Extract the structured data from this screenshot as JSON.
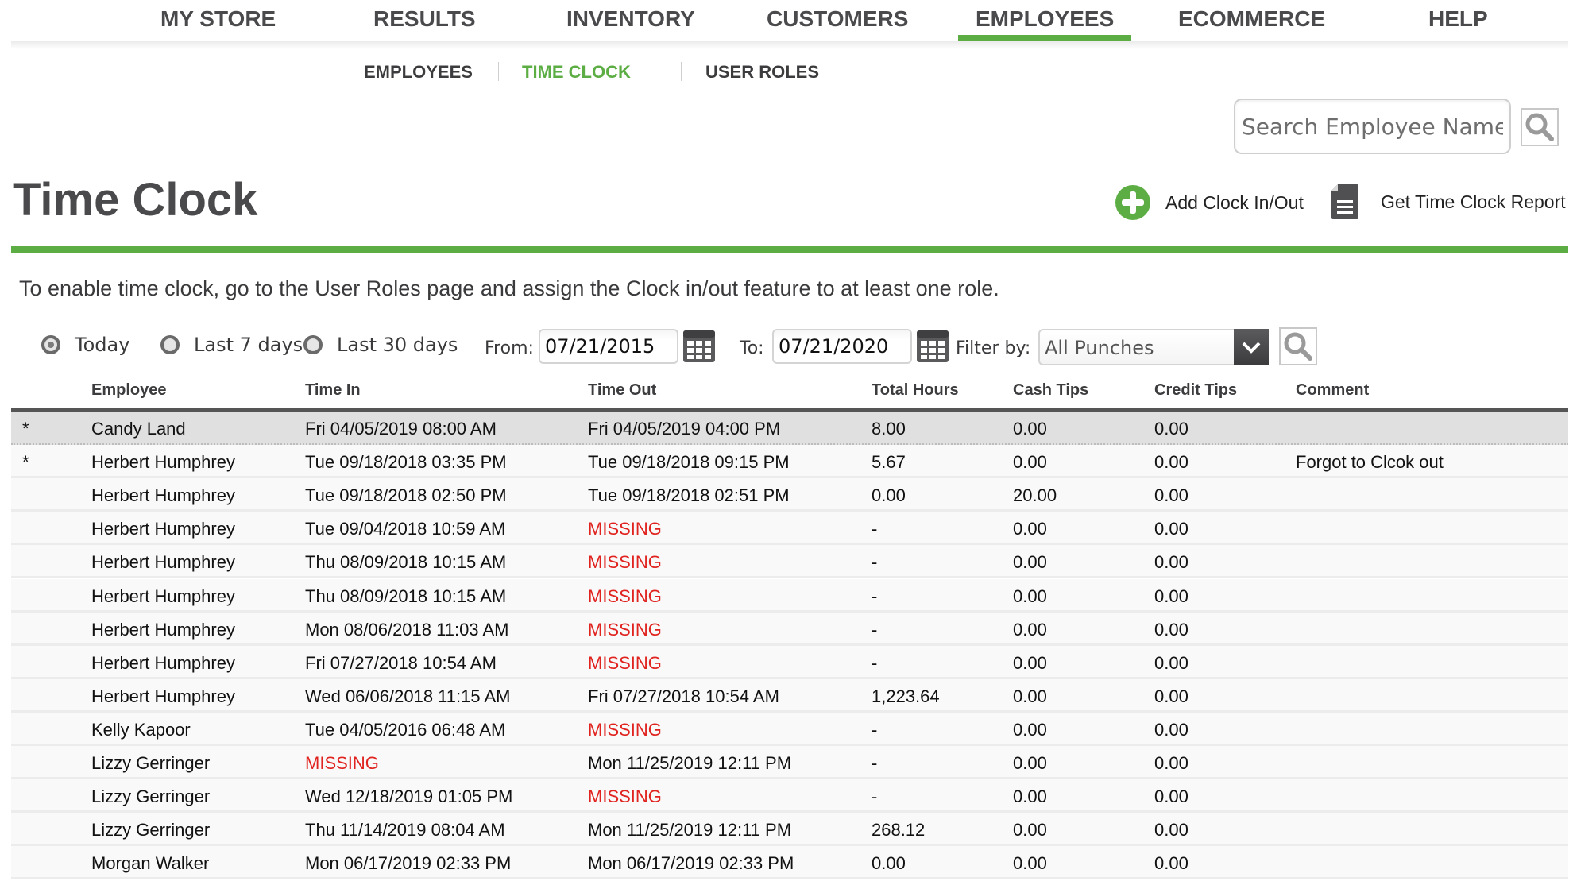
{
  "topnav": {
    "items": [
      {
        "label": "MY STORE"
      },
      {
        "label": "RESULTS"
      },
      {
        "label": "INVENTORY"
      },
      {
        "label": "CUSTOMERS"
      },
      {
        "label": "EMPLOYEES",
        "active": true
      },
      {
        "label": "ECOMMERCE"
      },
      {
        "label": "HELP"
      }
    ]
  },
  "subnav": {
    "items": [
      {
        "label": "EMPLOYEES"
      },
      {
        "label": "TIME CLOCK",
        "active": true
      },
      {
        "label": "USER ROLES"
      }
    ]
  },
  "search": {
    "placeholder": "Search Employee Name",
    "value": "",
    "icon": "magnifier-icon"
  },
  "page": {
    "title": "Time Clock",
    "actions": {
      "add_label": "Add Clock In/Out",
      "add_icon": "plus-circle-icon",
      "report_label": "Get Time Clock Report",
      "report_icon": "document-icon"
    },
    "notice": "To enable time clock, go to the User Roles page and assign the Clock in/out feature to at least one role."
  },
  "filters": {
    "radios": [
      {
        "label": "Today",
        "checked": true
      },
      {
        "label": "Last 7 days",
        "checked": false
      },
      {
        "label": "Last 30 days",
        "checked": false
      }
    ],
    "from_label": "From:",
    "from_value": "07/21/2015",
    "to_label": "To:",
    "to_value": "07/21/2020",
    "filter_label": "Filter by:",
    "filter_value": "All Punches"
  },
  "table": {
    "columns": [
      "Employee",
      "Time In",
      "Time Out",
      "Total Hours",
      "Cash Tips",
      "Credit Tips",
      "Comment"
    ],
    "rows": [
      {
        "flag": "*",
        "employee": "Candy Land",
        "time_in": "Fri 04/05/2019 08:00 AM",
        "time_out": "Fri 04/05/2019 04:00 PM",
        "total_hours": "8.00",
        "cash_tips": "0.00",
        "credit_tips": "0.00",
        "comment": "",
        "selected": true
      },
      {
        "flag": "*",
        "employee": "Herbert Humphrey",
        "time_in": "Tue 09/18/2018 03:35 PM",
        "time_out": "Tue 09/18/2018 09:15 PM",
        "total_hours": "5.67",
        "cash_tips": "0.00",
        "credit_tips": "0.00",
        "comment": "Forgot to Clcok out"
      },
      {
        "flag": "",
        "employee": "Herbert Humphrey",
        "time_in": "Tue 09/18/2018 02:50 PM",
        "time_out": "Tue 09/18/2018 02:51 PM",
        "total_hours": "0.00",
        "cash_tips": "20.00",
        "credit_tips": "0.00",
        "comment": ""
      },
      {
        "flag": "",
        "employee": "Herbert Humphrey",
        "time_in": "Tue 09/04/2018 10:59 AM",
        "time_out": "MISSING",
        "total_hours": "-",
        "cash_tips": "0.00",
        "credit_tips": "0.00",
        "comment": ""
      },
      {
        "flag": "",
        "employee": "Herbert Humphrey",
        "time_in": "Thu 08/09/2018 10:15 AM",
        "time_out": "MISSING",
        "total_hours": "-",
        "cash_tips": "0.00",
        "credit_tips": "0.00",
        "comment": ""
      },
      {
        "flag": "",
        "employee": "Herbert Humphrey",
        "time_in": "Thu 08/09/2018 10:15 AM",
        "time_out": "MISSING",
        "total_hours": "-",
        "cash_tips": "0.00",
        "credit_tips": "0.00",
        "comment": ""
      },
      {
        "flag": "",
        "employee": "Herbert Humphrey",
        "time_in": "Mon 08/06/2018 11:03 AM",
        "time_out": "MISSING",
        "total_hours": "-",
        "cash_tips": "0.00",
        "credit_tips": "0.00",
        "comment": ""
      },
      {
        "flag": "",
        "employee": "Herbert Humphrey",
        "time_in": "Fri 07/27/2018 10:54 AM",
        "time_out": "MISSING",
        "total_hours": "-",
        "cash_tips": "0.00",
        "credit_tips": "0.00",
        "comment": ""
      },
      {
        "flag": "",
        "employee": "Herbert Humphrey",
        "time_in": "Wed 06/06/2018 11:15 AM",
        "time_out": "Fri 07/27/2018 10:54 AM",
        "total_hours": "1,223.64",
        "cash_tips": "0.00",
        "credit_tips": "0.00",
        "comment": ""
      },
      {
        "flag": "",
        "employee": "Kelly Kapoor",
        "time_in": "Tue 04/05/2016 06:48 AM",
        "time_out": "MISSING",
        "total_hours": "-",
        "cash_tips": "0.00",
        "credit_tips": "0.00",
        "comment": ""
      },
      {
        "flag": "",
        "employee": "Lizzy Gerringer",
        "time_in": "MISSING",
        "time_out": "Mon 11/25/2019 12:11 PM",
        "total_hours": "-",
        "cash_tips": "0.00",
        "credit_tips": "0.00",
        "comment": ""
      },
      {
        "flag": "",
        "employee": "Lizzy Gerringer",
        "time_in": "Wed 12/18/2019 01:05 PM",
        "time_out": "MISSING",
        "total_hours": "-",
        "cash_tips": "0.00",
        "credit_tips": "0.00",
        "comment": ""
      },
      {
        "flag": "",
        "employee": "Lizzy Gerringer",
        "time_in": "Thu 11/14/2019 08:04 AM",
        "time_out": "Mon 11/25/2019 12:11 PM",
        "total_hours": "268.12",
        "cash_tips": "0.00",
        "credit_tips": "0.00",
        "comment": ""
      },
      {
        "flag": "",
        "employee": "Morgan Walker",
        "time_in": "Mon 06/17/2019 02:33 PM",
        "time_out": "Mon 06/17/2019 02:33 PM",
        "total_hours": "0.00",
        "cash_tips": "0.00",
        "credit_tips": "0.00",
        "comment": ""
      }
    ]
  },
  "colors": {
    "accent": "#5cae44",
    "missing": "#e0231f",
    "text_dark": "#4a4a4d"
  }
}
